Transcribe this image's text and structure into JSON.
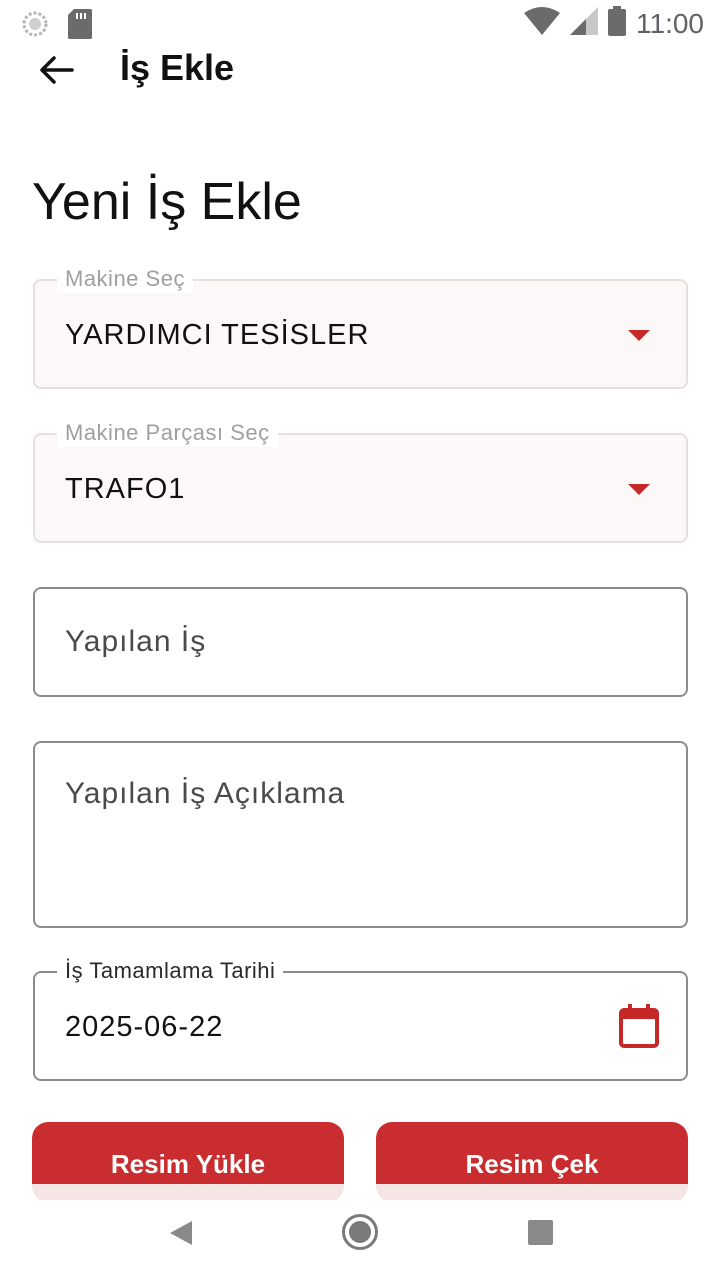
{
  "status_bar": {
    "time": "11:00",
    "icons": [
      "loading-icon",
      "sd-card-icon",
      "wifi-icon",
      "cell-signal-icon",
      "battery-icon"
    ]
  },
  "app_bar": {
    "title": "İş Ekle",
    "back_icon": "arrow-left-icon"
  },
  "page": {
    "heading": "Yeni İş Ekle"
  },
  "form": {
    "machine": {
      "label": "Makine Seç",
      "value": "YARDIMCI TESİSLER"
    },
    "machine_part": {
      "label": "Makine Parçası Seç",
      "value": "TRAFO1"
    },
    "work_done": {
      "placeholder": "Yapılan İş",
      "value": ""
    },
    "work_description": {
      "placeholder": "Yapılan İş Açıklama",
      "value": ""
    },
    "completion_date": {
      "label": "İş Tamamlama Tarihi",
      "value": "2025-06-22",
      "icon": "calendar-icon"
    }
  },
  "buttons": {
    "upload_image": "Resim Yükle",
    "take_photo": "Resim Çek"
  },
  "nav_bar": {
    "icons": [
      "nav-back-icon",
      "nav-home-icon",
      "nav-recent-apps-icon"
    ]
  },
  "colors": {
    "accent": "#c92d2f",
    "caret": "#c62828",
    "dropdown_bg": "#fdf8f8"
  }
}
